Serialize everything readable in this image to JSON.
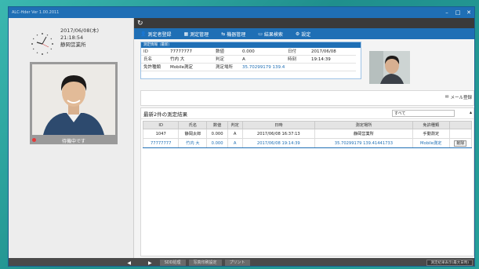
{
  "window": {
    "title": "ALC-Hder Ver 1.00.2011",
    "min": "–",
    "max": "□",
    "close": "✕"
  },
  "left": {
    "date": "2017/06/08(木)",
    "time": "21:18:54",
    "location": "静岡営業所",
    "status": "待機中です",
    "footer_arrow": "◀"
  },
  "topbar": {
    "icon": "↻"
  },
  "toolbar": {
    "items": [
      {
        "icon": "user-icon",
        "glyph": "👤",
        "label": "測定者登録"
      },
      {
        "icon": "grid-icon",
        "glyph": "▦",
        "label": "測定管理"
      },
      {
        "icon": "device-icon",
        "glyph": "⇆",
        "label": "機器管理"
      },
      {
        "icon": "calendar-icon",
        "glyph": "▭",
        "label": "結果検索"
      },
      {
        "icon": "gear-icon",
        "glyph": "⚙",
        "label": "設定"
      }
    ]
  },
  "info": {
    "header": "測定情報（最新）",
    "rows": [
      [
        "ID",
        "77777777",
        "数値",
        "0.000",
        "日付",
        "2017/06/08"
      ],
      [
        "氏名",
        "竹内 大",
        "判定",
        "A",
        "時刻",
        "19:14:39"
      ],
      [
        "免許種類",
        "Mobile測定",
        "測定場所",
        "35.70299179 139.41441733",
        "",
        ""
      ]
    ]
  },
  "message": {
    "mail_label": "メール登録"
  },
  "results": {
    "title": "最新2件の測定結果",
    "filter": "すべて",
    "columns": [
      "ID",
      "氏名",
      "数値",
      "判定",
      "日時",
      "測定場所",
      "免許種類"
    ],
    "rows": [
      [
        "1047",
        "静岡太郎",
        "0.000",
        "A",
        "2017/06/08 16:37:13",
        "静岡営業所",
        "手動測定",
        ""
      ],
      [
        "77777777",
        "竹内 大",
        "0.000",
        "A",
        "2017/06/08 19:14:39",
        "35.70299179 139.41441733",
        "Mobile測定",
        "削除"
      ]
    ]
  },
  "bottom": {
    "arrow": "▶",
    "buttons": [
      "SDD処理",
      "写真印刷設定",
      "プリント"
    ],
    "right_label": "測定結果表示(最大日時)"
  }
}
